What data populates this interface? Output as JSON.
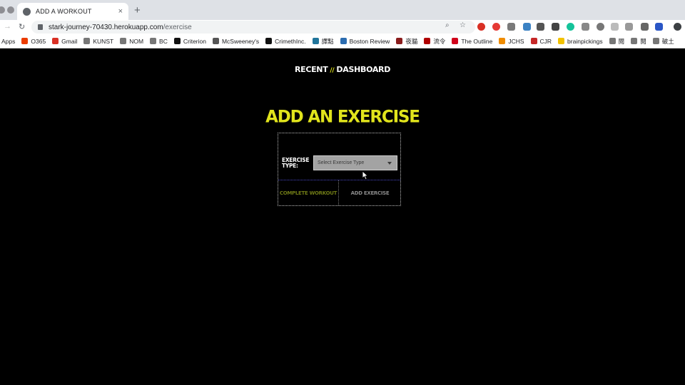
{
  "browser": {
    "tab_title": "ADD A WORKOUT",
    "tab_close": "×",
    "new_tab": "+",
    "url_host": "stark-journey-70430.herokuapp.com",
    "url_path": "/exercise",
    "back": "→",
    "reload": "↻",
    "zoom": "⌕",
    "star": "☆",
    "bookmarks": [
      {
        "label": "Apps",
        "color": "#1a73e8"
      },
      {
        "label": "O365",
        "color": "#eb3c00"
      },
      {
        "label": "Gmail",
        "color": "#d93025"
      },
      {
        "label": "KUNST",
        "color": "#777777"
      },
      {
        "label": "NOM",
        "color": "#777777"
      },
      {
        "label": "BC",
        "color": "#777777"
      },
      {
        "label": "Criterion",
        "color": "#111111"
      },
      {
        "label": "McSweeney's",
        "color": "#555555"
      },
      {
        "label": "CrimethInc.",
        "color": "#111111"
      },
      {
        "label": "譯點",
        "color": "#21759b"
      },
      {
        "label": "Boston Review",
        "color": "#2b6cb0"
      },
      {
        "label": "夜貓",
        "color": "#8a1c1c"
      },
      {
        "label": "流令",
        "color": "#b00000"
      },
      {
        "label": "The Outline",
        "color": "#d0021b"
      },
      {
        "label": "JCHS",
        "color": "#f08c00"
      },
      {
        "label": "CJR",
        "color": "#c62828"
      },
      {
        "label": "brainpickings",
        "color": "#f2c200"
      },
      {
        "label": "閱",
        "color": "#777777"
      },
      {
        "label": "閱",
        "color": "#777777"
      },
      {
        "label": "破土",
        "color": "#777777"
      }
    ]
  },
  "nav": {
    "recent": "RECENT",
    "separator": "//",
    "dashboard": "DASHBOARD"
  },
  "form": {
    "heading": "ADD AN EXERCISE",
    "type_label": "EXERCISE TYPE:",
    "type_placeholder": "Select Exercise Type",
    "complete_button": "COMPLETE WORKOUT",
    "add_button": "ADD EXERCISE"
  },
  "colors": {
    "accent": "#e1e41c",
    "background": "#000000"
  }
}
